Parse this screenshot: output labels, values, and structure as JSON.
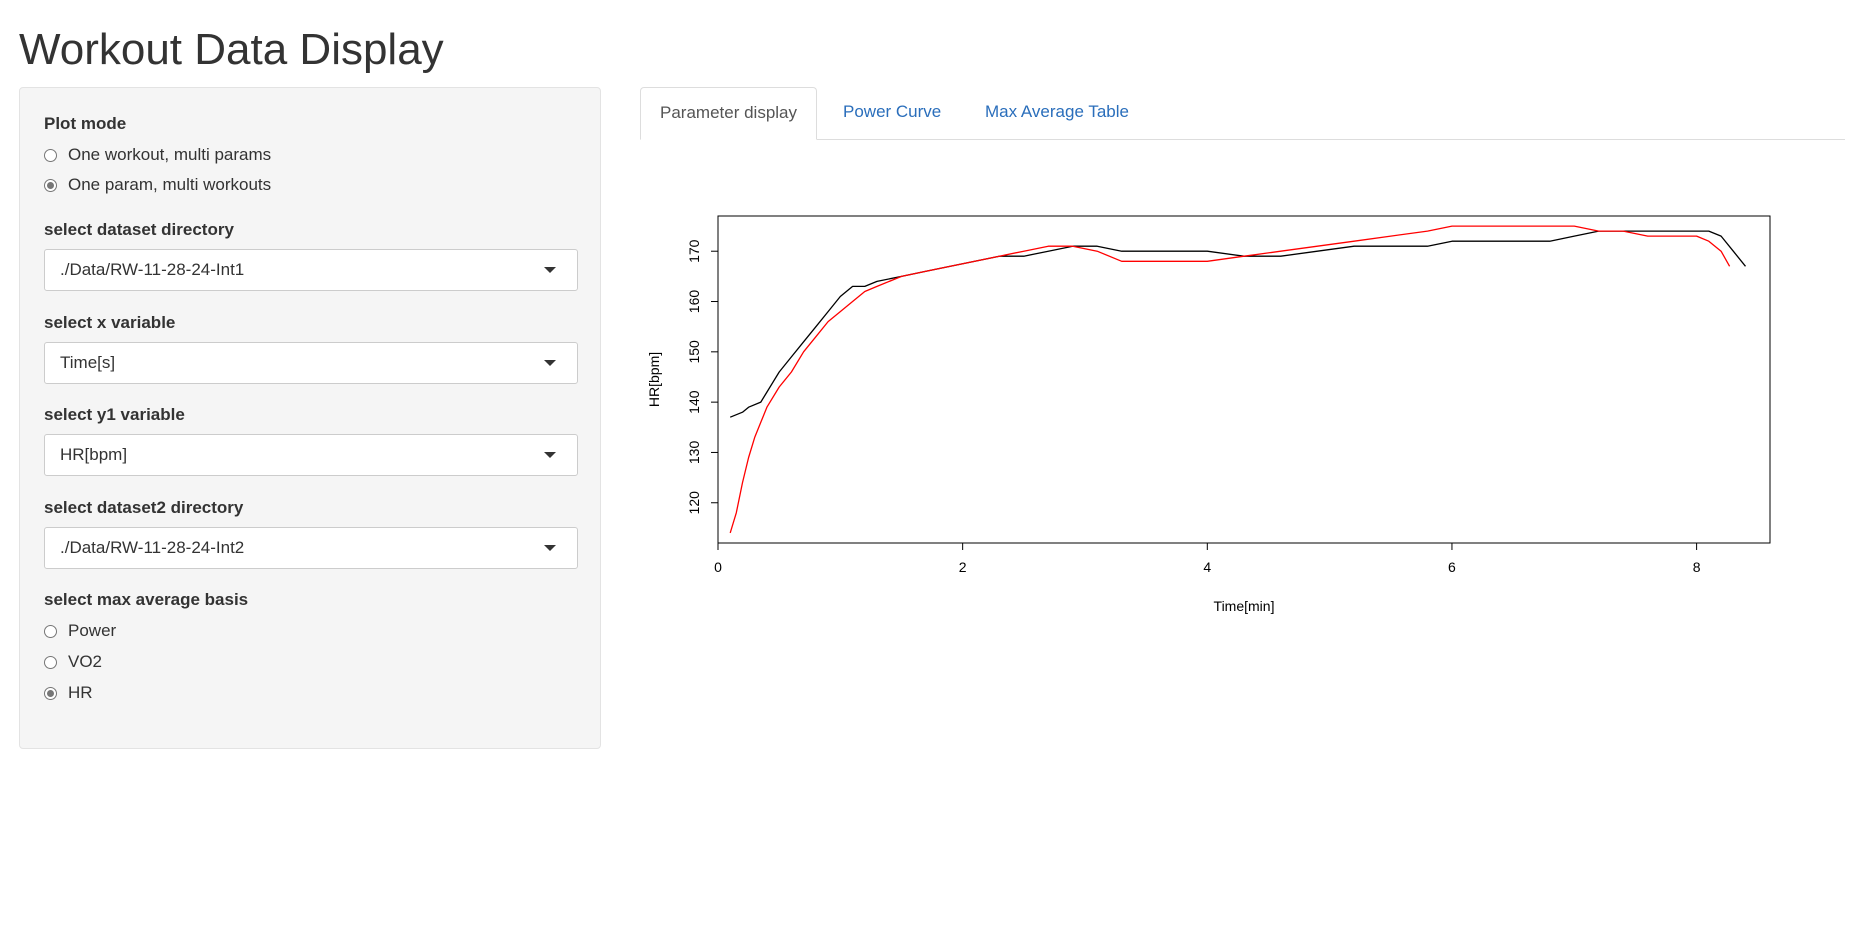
{
  "app": {
    "title": "Workout Data Display"
  },
  "sidebar": {
    "plot_mode": {
      "label": "Plot mode",
      "options": [
        "One workout, multi params",
        "One param, multi workouts"
      ],
      "selected_index": 1
    },
    "dataset_dir": {
      "label": "select dataset directory",
      "value": "./Data/RW-11-28-24-Int1"
    },
    "x_variable": {
      "label": "select x variable",
      "value": "Time[s]"
    },
    "y1_variable": {
      "label": "select y1 variable",
      "value": "HR[bpm]"
    },
    "dataset2_dir": {
      "label": "select dataset2 directory",
      "value": "./Data/RW-11-28-24-Int2"
    },
    "max_avg_basis": {
      "label": "select max average basis",
      "options": [
        "Power",
        "VO2",
        "HR"
      ],
      "selected_index": 2
    }
  },
  "tabs": [
    {
      "label": "Parameter display",
      "active": true
    },
    {
      "label": "Power Curve",
      "active": false
    },
    {
      "label": "Max Average Table",
      "active": false
    }
  ],
  "colors": {
    "link": "#2a6ebb",
    "series1": "#000000",
    "series2": "#ff0000"
  },
  "chart_data": {
    "type": "line",
    "title": "",
    "xlabel": "Time[min]",
    "ylabel": "HR[bpm]",
    "xlim": [
      0,
      8.6
    ],
    "ylim": [
      112,
      177
    ],
    "xticks": [
      0,
      2,
      4,
      6,
      8
    ],
    "yticks": [
      120,
      130,
      140,
      150,
      160,
      170
    ],
    "grid": false,
    "series": [
      {
        "color": "#000000",
        "x": [
          0.1,
          0.2,
          0.25,
          0.35,
          0.4,
          0.5,
          0.6,
          0.7,
          0.8,
          0.9,
          1.0,
          1.1,
          1.2,
          1.3,
          1.5,
          1.7,
          1.9,
          2.1,
          2.3,
          2.5,
          2.7,
          2.9,
          3.1,
          3.3,
          3.5,
          3.8,
          4.0,
          4.3,
          4.6,
          4.9,
          5.2,
          5.5,
          5.8,
          6.0,
          6.2,
          6.5,
          6.8,
          7.0,
          7.2,
          7.4,
          7.6,
          7.8,
          8.0,
          8.1,
          8.2,
          8.3,
          8.4
        ],
        "y": [
          137,
          138,
          139,
          140,
          142,
          146,
          149,
          152,
          155,
          158,
          161,
          163,
          163,
          164,
          165,
          166,
          167,
          168,
          169,
          169,
          170,
          171,
          171,
          170,
          170,
          170,
          170,
          169,
          169,
          170,
          171,
          171,
          171,
          172,
          172,
          172,
          172,
          173,
          174,
          174,
          174,
          174,
          174,
          174,
          173,
          170,
          167
        ]
      },
      {
        "color": "#ff0000",
        "x": [
          0.1,
          0.15,
          0.2,
          0.25,
          0.3,
          0.35,
          0.4,
          0.5,
          0.6,
          0.7,
          0.8,
          0.9,
          1.0,
          1.1,
          1.2,
          1.3,
          1.5,
          1.7,
          1.9,
          2.1,
          2.3,
          2.5,
          2.7,
          2.9,
          3.1,
          3.3,
          3.5,
          3.8,
          4.0,
          4.3,
          4.6,
          4.9,
          5.2,
          5.5,
          5.8,
          6.0,
          6.2,
          6.5,
          6.8,
          7.0,
          7.2,
          7.4,
          7.6,
          7.8,
          8.0,
          8.1,
          8.2,
          8.27
        ],
        "y": [
          114,
          118,
          124,
          129,
          133,
          136,
          139,
          143,
          146,
          150,
          153,
          156,
          158,
          160,
          162,
          163,
          165,
          166,
          167,
          168,
          169,
          170,
          171,
          171,
          170,
          168,
          168,
          168,
          168,
          169,
          170,
          171,
          172,
          173,
          174,
          175,
          175,
          175,
          175,
          175,
          174,
          174,
          173,
          173,
          173,
          172,
          170,
          167
        ]
      }
    ]
  }
}
